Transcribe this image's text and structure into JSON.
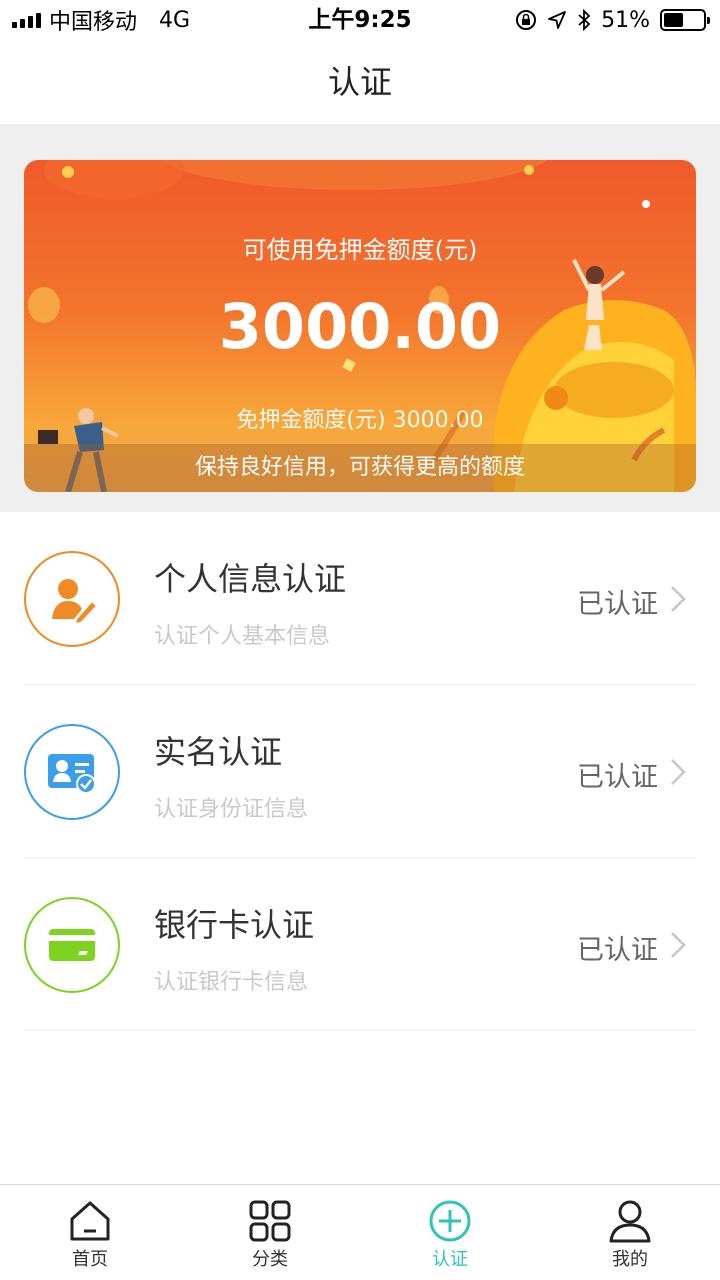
{
  "status_bar": {
    "carrier": "中国移动",
    "network": "4G",
    "time": "上午9:25",
    "battery_percent": "51%",
    "battery_level": 0.51,
    "icons": [
      "signal-icon",
      "lock-rotation-icon",
      "location-icon",
      "bluetooth-icon",
      "battery-icon"
    ]
  },
  "nav": {
    "title": "认证"
  },
  "banner": {
    "subtitle": "可使用免押金额度(元)",
    "amount": "3000.00",
    "limit_text": "免押金额度(元) 3000.00",
    "footer": "保持良好信用，可获得更高的额度"
  },
  "auth_items": [
    {
      "title": "个人信息认证",
      "desc": "认证个人基本信息",
      "status": "已认证",
      "icon": "user-edit-icon",
      "color": "#f08a24"
    },
    {
      "title": "实名认证",
      "desc": "认证身份证信息",
      "status": "已认证",
      "icon": "id-card-icon",
      "color": "#3b9ee8"
    },
    {
      "title": "银行卡认证",
      "desc": "认证银行卡信息",
      "status": "已认证",
      "icon": "bank-card-icon",
      "color": "#7ed321"
    }
  ],
  "tabbar": {
    "tabs": [
      {
        "label": "首页",
        "icon": "home-icon"
      },
      {
        "label": "分类",
        "icon": "grid-icon"
      },
      {
        "label": "认证",
        "icon": "add-circle-icon",
        "active": true
      },
      {
        "label": "我的",
        "icon": "person-icon"
      }
    ],
    "active_color": "#2ec4b6"
  }
}
